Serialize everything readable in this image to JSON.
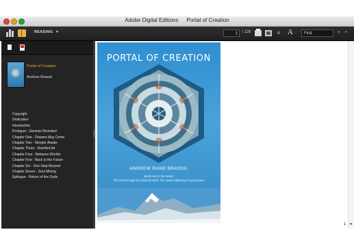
{
  "window": {
    "app_name": "Adobe Digital Editions",
    "doc_title": "Portal of Creation"
  },
  "toolbar": {
    "reading_label": "READING",
    "reading_caret": "▾",
    "page_current": "1",
    "page_total": "/ 128",
    "font_small": "A",
    "font_large": "A",
    "search_value": "Find",
    "nav_prev": "◂",
    "nav_next": "▸"
  },
  "sidebar": {
    "book": {
      "title": "Portal of Creation",
      "author": "Andrew Brassil"
    },
    "toc": [
      "Copyright",
      "Dedication",
      "Introduction",
      "Prologue - Genesis Revisited",
      "Chapter One - Dreams May Come",
      "Chapter Two - Sleeper Awake",
      "Chapter Three - Rarefied Air",
      "Chapter Four - Between Worlds",
      "Chapter Five - Back to the Future",
      "Chapter Six - One Step Beyond",
      "Chapter Seven - Soul Mining",
      "Epilogue - Return of the Gods"
    ]
  },
  "cover": {
    "title": "PORTAL OF CREATION",
    "author": "ANDREW RAND BRASSIL",
    "series_line": "Book One in the Series",
    "subtitle_line": "The Fractal Edge of Universal Mind: The Jewel Glittering in Hyperspace"
  },
  "viewer": {
    "page_number": "1",
    "scroll_arrow": "▼"
  },
  "colors": {
    "toolbar_bg": "#262626",
    "panel_bg": "#242424",
    "accent_title": "#e7a93a",
    "cover_blue": "#3a96d2"
  },
  "icons": {
    "library": "library-icon",
    "reading_view": "reading-view-icon",
    "print": "print-icon",
    "fit_page": "fit-page-icon",
    "bookmark": "bookmark-icon",
    "pdf": "pdf-icon"
  }
}
